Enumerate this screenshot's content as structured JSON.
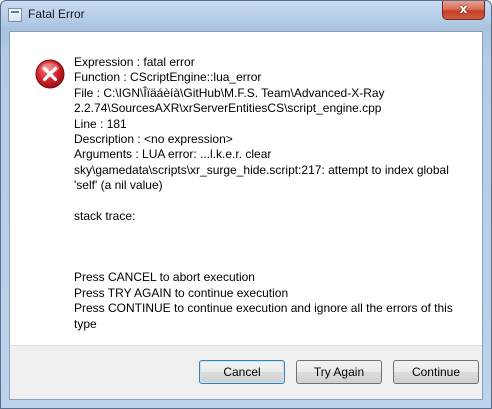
{
  "window": {
    "title": "Fatal Error",
    "close_glyph": "x",
    "icon": "application-window-icon",
    "close_color": "#c4402a"
  },
  "dialog": {
    "icon": "error-icon",
    "icon_color": "#c8202a",
    "lines": [
      "Expression    : fatal error",
      "Function      : CScriptEngine::lua_error",
      "File          : C:\\IGN\\Îïäáèíà\\GitHub\\M.F.S. Team\\Advanced-X-Ray",
      "2.2.74\\SourcesAXR\\xrServerEntitiesCS\\script_engine.cpp",
      "Line          : 181",
      "Description   : <no expression>",
      "Arguments     : LUA error: ...l.k.e.r. clear",
      "sky\\gamedata\\scripts\\xr_surge_hide.script:217: attempt to index global",
      "'self' (a nil value)",
      "",
      "stack trace:",
      "",
      "",
      "",
      "Press CANCEL to abort execution",
      "Press TRY AGAIN to continue execution",
      "Press CONTINUE to continue execution and ignore all the errors of this",
      "type"
    ]
  },
  "buttons": {
    "cancel": "Cancel",
    "try_again": "Try Again",
    "continue": "Continue"
  }
}
